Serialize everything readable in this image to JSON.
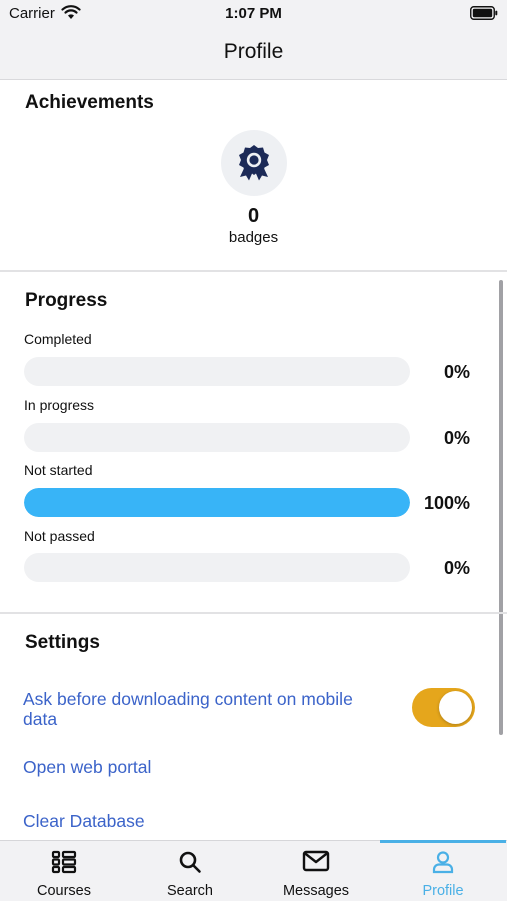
{
  "status_bar": {
    "carrier": "Carrier",
    "time": "1:07 PM"
  },
  "nav": {
    "title": "Profile"
  },
  "achievements": {
    "title": "Achievements",
    "badge_count": "0",
    "badge_label": "badges"
  },
  "progress": {
    "title": "Progress",
    "items": [
      {
        "label": "Completed",
        "percent": 0,
        "percent_text": "0%"
      },
      {
        "label": "In progress",
        "percent": 0,
        "percent_text": "0%"
      },
      {
        "label": "Not started",
        "percent": 100,
        "percent_text": "100%"
      },
      {
        "label": "Not passed",
        "percent": 0,
        "percent_text": "0%"
      }
    ]
  },
  "settings": {
    "title": "Settings",
    "mobile_data_label": "Ask before downloading content on mobile data",
    "mobile_data_enabled": true,
    "open_web_portal": "Open web portal",
    "clear_database": "Clear Database"
  },
  "tabs": [
    {
      "label": "Courses",
      "icon": "courses-icon",
      "active": false
    },
    {
      "label": "Search",
      "icon": "search-icon",
      "active": false
    },
    {
      "label": "Messages",
      "icon": "messages-icon",
      "active": false
    },
    {
      "label": "Profile",
      "icon": "profile-icon",
      "active": true
    }
  ],
  "colors": {
    "accent_blue": "#38b4f7",
    "link_blue": "#3b63c9",
    "toggle_on": "#e5a61c",
    "tab_active": "#4ab0e6"
  }
}
